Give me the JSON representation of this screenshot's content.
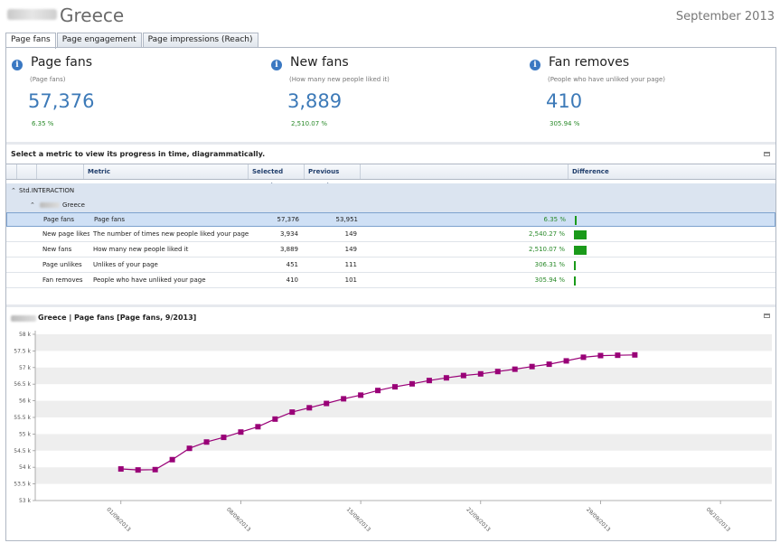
{
  "header": {
    "title": "Greece",
    "period": "September 2013"
  },
  "tabs": [
    {
      "label": "Page fans",
      "active": true
    },
    {
      "label": "Page engagement",
      "active": false
    },
    {
      "label": "Page impressions (Reach)",
      "active": false
    }
  ],
  "kpis": [
    {
      "title": "Page fans",
      "subtitle": "(Page fans)",
      "value": "57,376",
      "change": "6.35 %"
    },
    {
      "title": "New fans",
      "subtitle": "(How many new people liked it)",
      "value": "3,889",
      "change": "2,510.07 %"
    },
    {
      "title": "Fan removes",
      "subtitle": "(People who have unliked your page)",
      "value": "410",
      "change": "305.94 %"
    }
  ],
  "metrics": {
    "header_text": "Select a metric to view its progress in time, diagrammatically.",
    "columns": {
      "metric": "Metric",
      "selected": "Selected month",
      "previous": "Previous month",
      "difference": "Difference"
    },
    "group": "Std.INTERACTION",
    "subgroup": "Greece",
    "rows": [
      {
        "name": "Page fans",
        "metric": "Page fans",
        "selected": "57,376",
        "previous": "53,951",
        "difference": "6.35 %",
        "diff_level": 0.0025,
        "selected_row": true
      },
      {
        "name": "New page likes",
        "metric": "The number of times new people liked your page",
        "selected": "3,934",
        "previous": "149",
        "difference": "2,540.27 %",
        "diff_level": 1.0,
        "selected_row": false
      },
      {
        "name": "New fans",
        "metric": "How many new people liked it",
        "selected": "3,889",
        "previous": "149",
        "difference": "2,510.07 %",
        "diff_level": 0.99,
        "selected_row": false
      },
      {
        "name": "Page unlikes",
        "metric": "Unlikes of your page",
        "selected": "451",
        "previous": "111",
        "difference": "306.31 %",
        "diff_level": 0.12,
        "selected_row": false
      },
      {
        "name": "Fan removes",
        "metric": "People who have unliked your page",
        "selected": "410",
        "previous": "101",
        "difference": "305.94 %",
        "diff_level": 0.12,
        "selected_row": false
      }
    ]
  },
  "chart": {
    "title": "Greece | Page fans [Page fans, 9/2013]"
  },
  "chart_data": {
    "type": "line",
    "title": "Greece | Page fans [Page fans, 9/2013]",
    "y_tick_labels": [
      "53 k",
      "53.5 k",
      "54 k",
      "54.5 k",
      "55 k",
      "55.5 k",
      "56 k",
      "56.5 k",
      "57 k",
      "57.5 k",
      "58 k"
    ],
    "ylim": [
      53000,
      58000
    ],
    "x_tick_labels": [
      "01/09/2013",
      "08/09/2013",
      "15/09/2013",
      "22/09/2013",
      "29/09/2013",
      "06/10/2013"
    ],
    "x_range": [
      "2013-08-27",
      "2013-10-09"
    ],
    "x": [
      "2013-09-01",
      "2013-09-02",
      "2013-09-03",
      "2013-09-04",
      "2013-09-05",
      "2013-09-06",
      "2013-09-07",
      "2013-09-08",
      "2013-09-09",
      "2013-09-10",
      "2013-09-11",
      "2013-09-12",
      "2013-09-13",
      "2013-09-14",
      "2013-09-15",
      "2013-09-16",
      "2013-09-17",
      "2013-09-18",
      "2013-09-19",
      "2013-09-20",
      "2013-09-21",
      "2013-09-22",
      "2013-09-23",
      "2013-09-24",
      "2013-09-25",
      "2013-09-26",
      "2013-09-27",
      "2013-09-28",
      "2013-09-29",
      "2013-09-30",
      "2013-10-01"
    ],
    "series": [
      {
        "values": [
          53950,
          53920,
          53930,
          54230,
          54570,
          54760,
          54900,
          55060,
          55220,
          55450,
          55660,
          55790,
          55920,
          56060,
          56170,
          56310,
          56420,
          56510,
          56610,
          56690,
          56760,
          56810,
          56880,
          56950,
          57030,
          57100,
          57200,
          57310,
          57360,
          57370,
          57380
        ]
      }
    ],
    "color": "#990077",
    "band_color": "#eeeeee",
    "grid": true
  }
}
